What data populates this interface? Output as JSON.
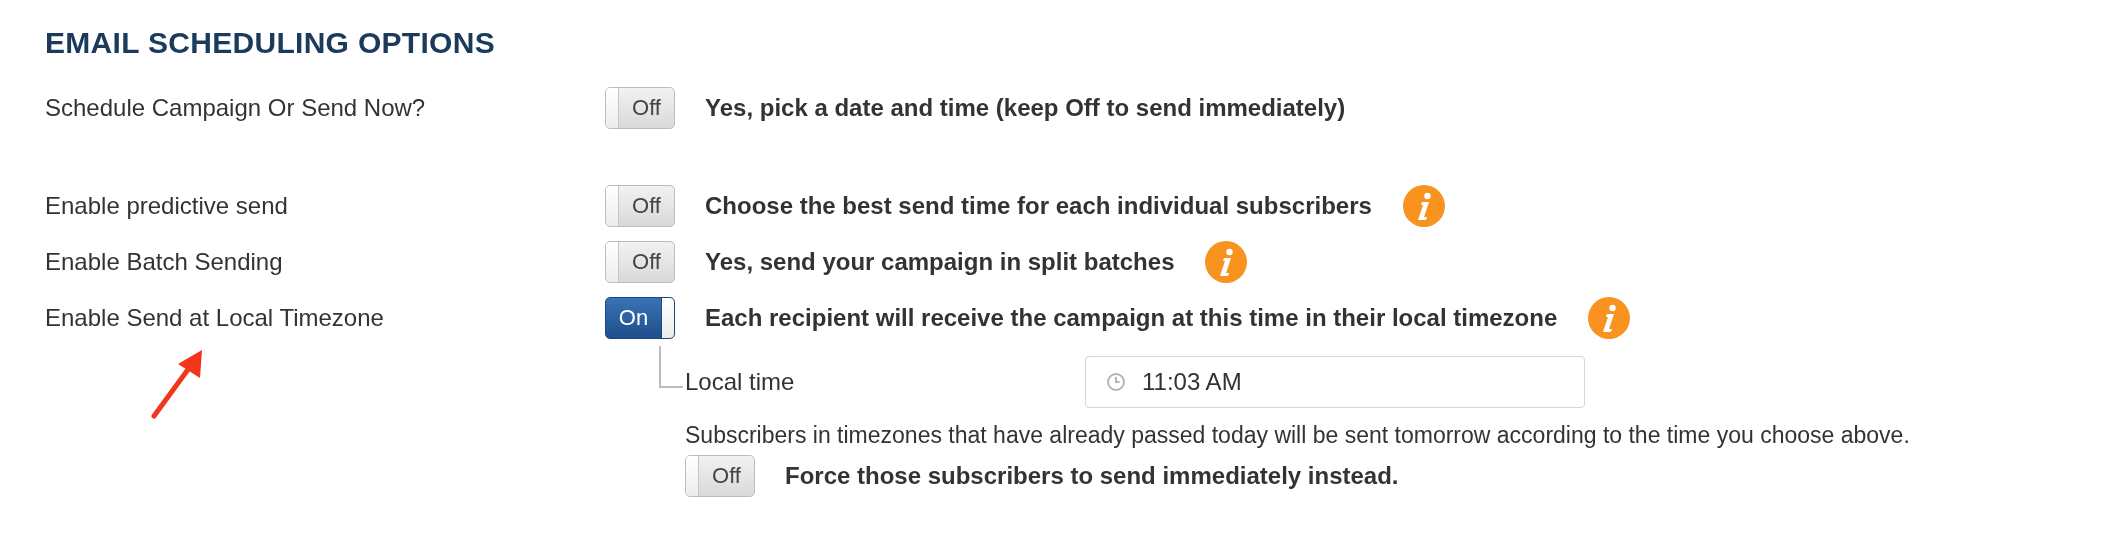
{
  "title": "EMAIL SCHEDULING OPTIONS",
  "options": [
    {
      "label": "Schedule Campaign Or Send Now?",
      "toggle": {
        "on": false,
        "text": "Off"
      },
      "description": "Yes, pick a date and time (keep Off to send immediately)",
      "info": false
    },
    {
      "label": "Enable predictive send",
      "toggle": {
        "on": false,
        "text": "Off"
      },
      "description": "Choose the best send time for each individual subscribers",
      "info": true
    },
    {
      "label": "Enable Batch Sending",
      "toggle": {
        "on": false,
        "text": "Off"
      },
      "description": "Yes, send your campaign in split batches",
      "info": true
    },
    {
      "label": "Enable Send at Local Timezone",
      "toggle": {
        "on": true,
        "text": "On"
      },
      "description": "Each recipient will receive the campaign at this time in their local timezone",
      "info": true
    }
  ],
  "local_time": {
    "label": "Local time",
    "value": "11:03 AM"
  },
  "note": "Subscribers in timezones that have already passed today will be sent tomorrow according to the time you choose above.",
  "force": {
    "toggle": {
      "on": false,
      "text": "Off"
    },
    "description": "Force those subscribers to send immediately instead."
  }
}
